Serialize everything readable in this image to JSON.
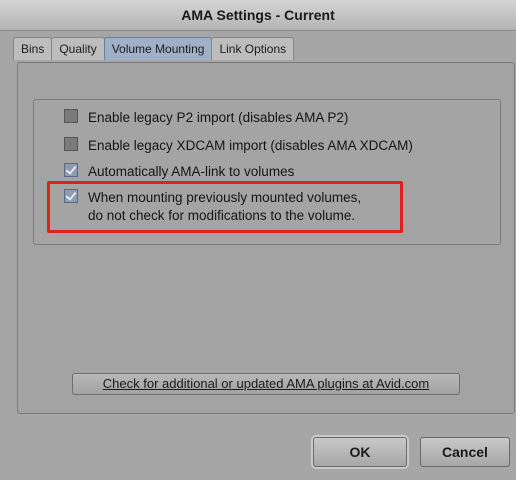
{
  "window": {
    "title": "AMA Settings - Current"
  },
  "tabs": [
    {
      "label": "Bins",
      "active": false
    },
    {
      "label": "Quality",
      "active": false
    },
    {
      "label": "Volume Mounting",
      "active": true
    },
    {
      "label": "Link Options",
      "active": false
    }
  ],
  "options": [
    {
      "label": "Enable legacy P2 import (disables AMA P2)",
      "checked": false
    },
    {
      "label": "Enable legacy XDCAM import (disables AMA XDCAM)",
      "checked": false
    },
    {
      "label": "Automatically AMA-link to volumes",
      "checked": true
    },
    {
      "label_line1": "When mounting previously mounted volumes,",
      "label_line2": "do not check for modifications to the volume.",
      "checked": true
    }
  ],
  "link_button": {
    "label": "Check for additional or updated AMA plugins at Avid.com"
  },
  "buttons": {
    "ok": "OK",
    "cancel": "Cancel"
  },
  "colors": {
    "highlight_annotation": "#e0201c",
    "active_tab": "#9fb0c8"
  }
}
